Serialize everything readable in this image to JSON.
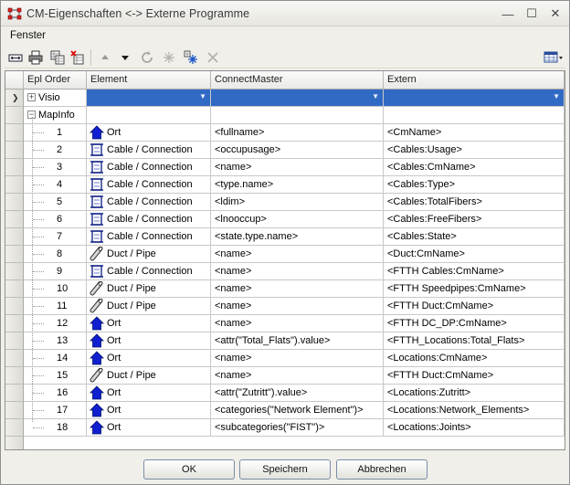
{
  "window": {
    "title": "CM-Eigenschaften <-> Externe Programme",
    "minimize": "—",
    "maximize": "☐",
    "close": "✕"
  },
  "menu": {
    "items": [
      "Fenster"
    ]
  },
  "grid": {
    "columns": [
      "Epl Order",
      "Element",
      "ConnectMaster",
      "Extern"
    ],
    "groups": [
      {
        "label": "Visio",
        "expander": "+"
      },
      {
        "label": "MapInfo",
        "expander": "−"
      }
    ],
    "rows": [
      {
        "order": "1",
        "type": "ort",
        "element": "Ort",
        "cm": "<fullname>",
        "extern": "<CmName>"
      },
      {
        "order": "2",
        "type": "cable",
        "element": "Cable / Connection",
        "cm": "<occupusage>",
        "extern": "<Cables:Usage>"
      },
      {
        "order": "3",
        "type": "cable",
        "element": "Cable / Connection",
        "cm": "<name>",
        "extern": "<Cables:CmName>"
      },
      {
        "order": "4",
        "type": "cable",
        "element": "Cable / Connection",
        "cm": "<type.name>",
        "extern": "<Cables:Type>"
      },
      {
        "order": "5",
        "type": "cable",
        "element": "Cable / Connection",
        "cm": "<ldim>",
        "extern": "<Cables:TotalFibers>"
      },
      {
        "order": "6",
        "type": "cable",
        "element": "Cable / Connection",
        "cm": "<lnooccup>",
        "extern": "<Cables:FreeFibers>"
      },
      {
        "order": "7",
        "type": "cable",
        "element": "Cable / Connection",
        "cm": "<state.type.name>",
        "extern": "<Cables:State>"
      },
      {
        "order": "8",
        "type": "duct",
        "element": "Duct / Pipe",
        "cm": "<name>",
        "extern": "<Duct:CmName>"
      },
      {
        "order": "9",
        "type": "cable",
        "element": "Cable / Connection",
        "cm": "<name>",
        "extern": "<FTTH Cables:CmName>"
      },
      {
        "order": "10",
        "type": "duct",
        "element": "Duct / Pipe",
        "cm": "<name>",
        "extern": "<FTTH Speedpipes:CmName>"
      },
      {
        "order": "11",
        "type": "duct",
        "element": "Duct / Pipe",
        "cm": "<name>",
        "extern": "<FTTH Duct:CmName>"
      },
      {
        "order": "12",
        "type": "ort",
        "element": "Ort",
        "cm": "<name>",
        "extern": "<FTTH DC_DP:CmName>"
      },
      {
        "order": "13",
        "type": "ort",
        "element": "Ort",
        "cm": "<attr(\"Total_Flats\").value>",
        "extern": "<FTTH_Locations:Total_Flats>"
      },
      {
        "order": "14",
        "type": "ort",
        "element": "Ort",
        "cm": "<name>",
        "extern": "<Locations:CmName>"
      },
      {
        "order": "15",
        "type": "duct",
        "element": "Duct / Pipe",
        "cm": "<name>",
        "extern": "<FTTH Duct:CmName>"
      },
      {
        "order": "16",
        "type": "ort",
        "element": "Ort",
        "cm": "<attr(\"Zutritt\").value>",
        "extern": "<Locations:Zutritt>"
      },
      {
        "order": "17",
        "type": "ort",
        "element": "Ort",
        "cm": "<categories(\"Network Element\")>",
        "extern": "<Locations:Network_Elements>"
      },
      {
        "order": "18",
        "type": "ort",
        "element": "Ort",
        "cm": "<subcategories(\"FIST\")>",
        "extern": "<Locations:Joints>"
      }
    ]
  },
  "footer": {
    "ok": "OK",
    "save": "Speichern",
    "cancel": "Abbrechen"
  },
  "colors": {
    "selection": "#316ac5",
    "ort_icon": "#1020d0",
    "cable_icon": "#1a2a8a"
  }
}
